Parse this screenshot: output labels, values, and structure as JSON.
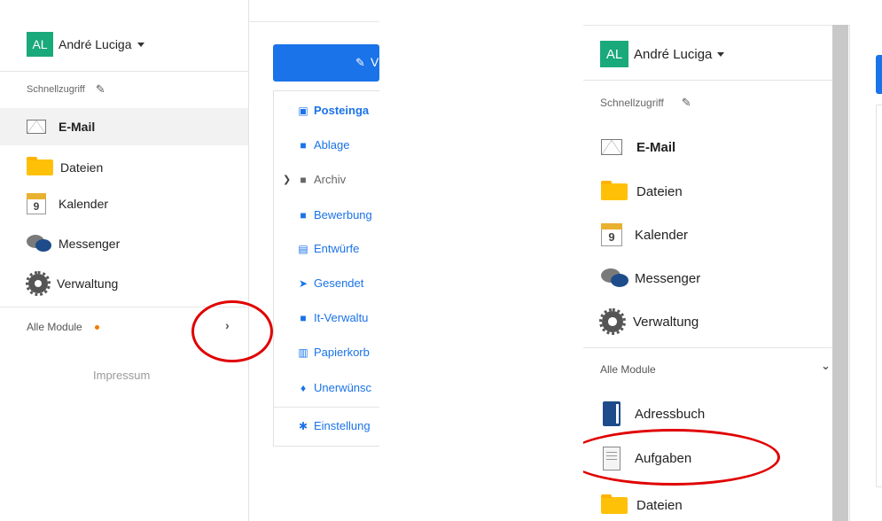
{
  "user": {
    "initials": "AL",
    "name": "André Luciga"
  },
  "quick_access": "Schnellzugriff",
  "nav": [
    {
      "label": "E-Mail",
      "icon": "mail-icon",
      "active": true
    },
    {
      "label": "Dateien",
      "icon": "folder-icon"
    },
    {
      "label": "Kalender",
      "icon": "calendar-icon",
      "day": "9"
    },
    {
      "label": "Messenger",
      "icon": "messenger-icon"
    },
    {
      "label": "Verwaltung",
      "icon": "gear-icon"
    }
  ],
  "modules_label": "Alle Module",
  "expanded_modules": [
    {
      "label": "Adressbuch",
      "icon": "addressbook-icon"
    },
    {
      "label": "Aufgaben",
      "icon": "tasks-icon"
    },
    {
      "label": "Dateien",
      "icon": "folder-icon"
    }
  ],
  "impressum": "Impressum",
  "new_button_label": "V",
  "folders": [
    {
      "label": "Posteinga",
      "icon": "inbox-icon"
    },
    {
      "label": "Ablage",
      "icon": "folder-icon"
    },
    {
      "label": "Archiv",
      "icon": "folder-icon"
    },
    {
      "label": "Bewerbung",
      "icon": "folder-icon"
    },
    {
      "label": "Entwürfe",
      "icon": "drafts-icon"
    },
    {
      "label": "Gesendet",
      "icon": "sent-icon"
    },
    {
      "label": "It-Verwaltu",
      "icon": "folder-icon"
    },
    {
      "label": "Papierkorb",
      "icon": "trash-icon"
    },
    {
      "label": "Unerwünsc",
      "icon": "spam-icon"
    },
    {
      "label": "Einstellung",
      "icon": "settings-icon"
    }
  ],
  "colors": {
    "accent": "#1a73e8",
    "avatar": "#1aa97a",
    "highlight": "#e00000",
    "notify": "#f07c00"
  }
}
